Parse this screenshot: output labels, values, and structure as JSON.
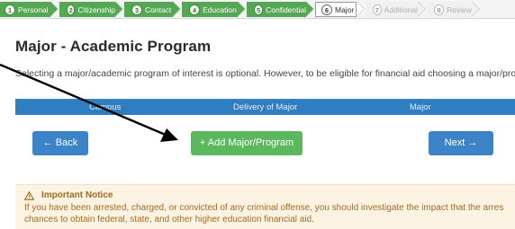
{
  "steps": [
    {
      "num": "1",
      "label": "Personal",
      "state": "done"
    },
    {
      "num": "2",
      "label": "Citizenship",
      "state": "done"
    },
    {
      "num": "3",
      "label": "Contact",
      "state": "done"
    },
    {
      "num": "4",
      "label": "Education",
      "state": "done"
    },
    {
      "num": "5",
      "label": "Confidential",
      "state": "done"
    },
    {
      "num": "6",
      "label": "Major",
      "state": "active"
    },
    {
      "num": "7",
      "label": "Additional",
      "state": "todo"
    },
    {
      "num": "8",
      "label": "Review",
      "state": "todo"
    }
  ],
  "page": {
    "title": "Major - Academic Program",
    "intro": "Selecting a major/academic program of interest is optional. However, to be eligible for financial aid choosing a major/pro"
  },
  "table": {
    "headers": [
      "Campus",
      "Delivery of Major",
      "Major"
    ]
  },
  "buttons": {
    "back": "← Back",
    "add": "+ Add Major/Program",
    "next": "Next →"
  },
  "notice": {
    "title": "Important Notice",
    "line1": "If you have been arrested, charged, or convicted of any criminal offense, you should investigate the impact that the arres",
    "line2": "chances to obtain federal, state, and other higher education financial aid."
  },
  "colors": {
    "step_done": "#54a854",
    "table_header": "#2f7ec2",
    "primary_button": "#3c83c8",
    "success_button": "#5cb85c",
    "notice_bg": "#fcf3e2",
    "notice_text": "#a06b23"
  }
}
